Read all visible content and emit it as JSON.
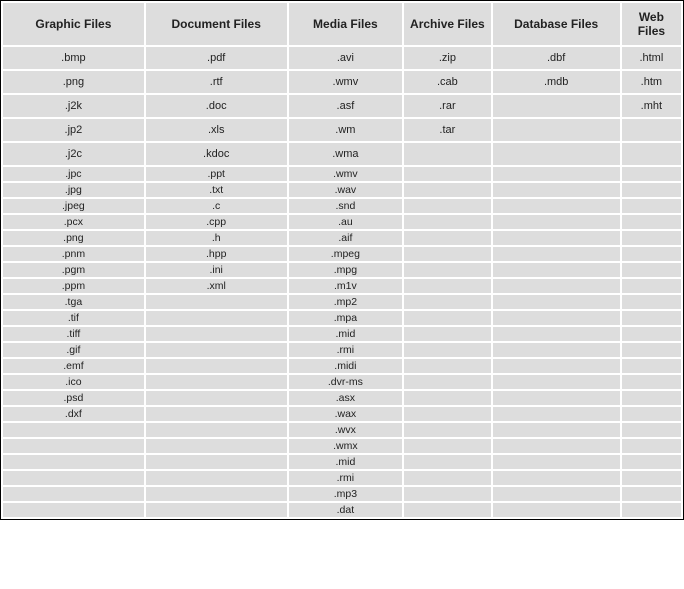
{
  "headers": {
    "graphic": "Graphic Files",
    "document": "Document Files",
    "media": "Media Files",
    "archive": "Archive Files",
    "database": "Database Files",
    "web": "Web Files"
  },
  "rows": [
    {
      "pad": true,
      "graphic": ".bmp",
      "document": ".pdf",
      "media": ".avi",
      "archive": ".zip",
      "database": ".dbf",
      "web": ".html"
    },
    {
      "pad": true,
      "graphic": ".png",
      "document": ".rtf",
      "media": ".wmv",
      "archive": ".cab",
      "database": ".mdb",
      "web": ".htm"
    },
    {
      "pad": true,
      "graphic": ".j2k",
      "document": ".doc",
      "media": ".asf",
      "archive": ".rar",
      "database": "",
      "web": ".mht"
    },
    {
      "pad": true,
      "graphic": ".jp2",
      "document": ".xls",
      "media": ".wm",
      "archive": ".tar",
      "database": "",
      "web": ""
    },
    {
      "pad": true,
      "graphic": ".j2c",
      "document": ".kdoc",
      "media": ".wma",
      "archive": "",
      "database": "",
      "web": ""
    },
    {
      "pad": false,
      "graphic": ".jpc",
      "document": ".ppt",
      "media": ".wmv",
      "archive": "",
      "database": "",
      "web": ""
    },
    {
      "pad": false,
      "graphic": ".jpg",
      "document": ".txt",
      "media": ".wav",
      "archive": "",
      "database": "",
      "web": ""
    },
    {
      "pad": false,
      "graphic": ".jpeg",
      "document": ".c",
      "media": ".snd",
      "archive": "",
      "database": "",
      "web": ""
    },
    {
      "pad": false,
      "graphic": ".pcx",
      "document": ".cpp",
      "media": ".au",
      "archive": "",
      "database": "",
      "web": ""
    },
    {
      "pad": false,
      "graphic": ".png",
      "document": ".h",
      "media": ".aif",
      "archive": "",
      "database": "",
      "web": ""
    },
    {
      "pad": false,
      "graphic": ".pnm",
      "document": ".hpp",
      "media": ".mpeg",
      "archive": "",
      "database": "",
      "web": ""
    },
    {
      "pad": false,
      "graphic": ".pgm",
      "document": ".ini",
      "media": ".mpg",
      "archive": "",
      "database": "",
      "web": ""
    },
    {
      "pad": false,
      "graphic": ".ppm",
      "document": ".xml",
      "media": ".m1v",
      "archive": "",
      "database": "",
      "web": ""
    },
    {
      "pad": false,
      "graphic": ".tga",
      "document": "",
      "media": ".mp2",
      "archive": "",
      "database": "",
      "web": ""
    },
    {
      "pad": false,
      "graphic": ".tif",
      "document": "",
      "media": ".mpa",
      "archive": "",
      "database": "",
      "web": ""
    },
    {
      "pad": false,
      "graphic": ".tiff",
      "document": "",
      "media": ".mid",
      "archive": "",
      "database": "",
      "web": ""
    },
    {
      "pad": false,
      "graphic": ".gif",
      "document": "",
      "media": ".rmi",
      "archive": "",
      "database": "",
      "web": ""
    },
    {
      "pad": false,
      "graphic": ".emf",
      "document": "",
      "media": ".midi",
      "archive": "",
      "database": "",
      "web": ""
    },
    {
      "pad": false,
      "graphic": ".ico",
      "document": "",
      "media": ".dvr-ms",
      "archive": "",
      "database": "",
      "web": ""
    },
    {
      "pad": false,
      "graphic": ".psd",
      "document": "",
      "media": ".asx",
      "archive": "",
      "database": "",
      "web": ""
    },
    {
      "pad": false,
      "graphic": ".dxf",
      "document": "",
      "media": ".wax",
      "archive": "",
      "database": "",
      "web": ""
    },
    {
      "pad": false,
      "graphic": "",
      "document": "",
      "media": ".wvx",
      "archive": "",
      "database": "",
      "web": ""
    },
    {
      "pad": false,
      "graphic": "",
      "document": "",
      "media": ".wmx",
      "archive": "",
      "database": "",
      "web": ""
    },
    {
      "pad": false,
      "graphic": "",
      "document": "",
      "media": ".mid",
      "archive": "",
      "database": "",
      "web": ""
    },
    {
      "pad": false,
      "graphic": "",
      "document": "",
      "media": ".rmi",
      "archive": "",
      "database": "",
      "web": ""
    },
    {
      "pad": false,
      "graphic": "",
      "document": "",
      "media": ".mp3",
      "archive": "",
      "database": "",
      "web": ""
    },
    {
      "pad": false,
      "graphic": "",
      "document": "",
      "media": ".dat",
      "archive": "",
      "database": "",
      "web": ""
    }
  ]
}
